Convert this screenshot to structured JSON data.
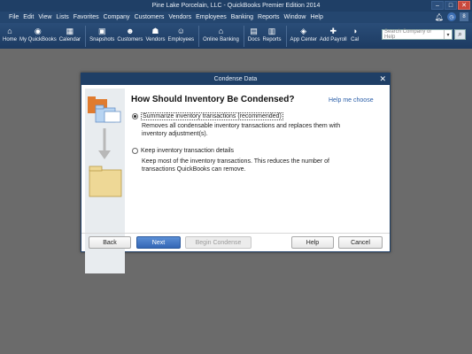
{
  "window": {
    "title": "Pine Lake Porcelain, LLC  - QuickBooks Premier Edition 2014"
  },
  "menu": [
    "File",
    "Edit",
    "View",
    "Lists",
    "Favorites",
    "Company",
    "Customers",
    "Vendors",
    "Employees",
    "Banking",
    "Reports",
    "Window",
    "Help"
  ],
  "menu_right_badge": "8",
  "toolbar": {
    "items": [
      {
        "label": "Home",
        "icon": "home-icon",
        "glyph": "⌂"
      },
      {
        "label": "My QuickBooks",
        "icon": "my-quickbooks-icon",
        "glyph": "◉"
      },
      {
        "label": "Calendar",
        "icon": "calendar-icon",
        "glyph": "▦"
      },
      {
        "label": "Snapshots",
        "icon": "snapshots-icon",
        "glyph": "▣"
      },
      {
        "label": "Customers",
        "icon": "customers-icon",
        "glyph": "☻"
      },
      {
        "label": "Vendors",
        "icon": "vendors-icon",
        "glyph": "☗"
      },
      {
        "label": "Employees",
        "icon": "employees-icon",
        "glyph": "☺"
      },
      {
        "label": "Online Banking",
        "icon": "online-banking-icon",
        "glyph": "⌂"
      },
      {
        "label": "Docs",
        "icon": "docs-icon",
        "glyph": "▤"
      },
      {
        "label": "Reports",
        "icon": "reports-icon",
        "glyph": "▥"
      },
      {
        "label": "App Center",
        "icon": "app-center-icon",
        "glyph": "◈"
      },
      {
        "label": "Add Payroll",
        "icon": "add-payroll-icon",
        "glyph": "✚"
      },
      {
        "label": "Cal",
        "icon": "cal-icon",
        "glyph": "◑"
      }
    ],
    "search_placeholder": "Search Company or Help"
  },
  "dialog": {
    "title": "Condense Data",
    "heading": "How Should Inventory Be Condensed?",
    "help_link": "Help me choose",
    "options": [
      {
        "label": "Summarize inventory transactions (recommended)",
        "selected": true,
        "description": "Removes all condensable inventory transactions and replaces them with inventory adjustment(s)."
      },
      {
        "label": "Keep inventory transaction details",
        "selected": false,
        "description": "Keep most of the inventory transactions.  This reduces the number of transactions QuickBooks can remove."
      }
    ],
    "buttons": {
      "back": "Back",
      "next": "Next",
      "begin": "Begin Condense",
      "help": "Help",
      "cancel": "Cancel"
    }
  },
  "colors": {
    "titlebar": "#1f3f66",
    "menubar": "#24466f",
    "workspace": "#6b6b6b",
    "primary_button": "#3366b5",
    "link": "#2a5ea8"
  }
}
